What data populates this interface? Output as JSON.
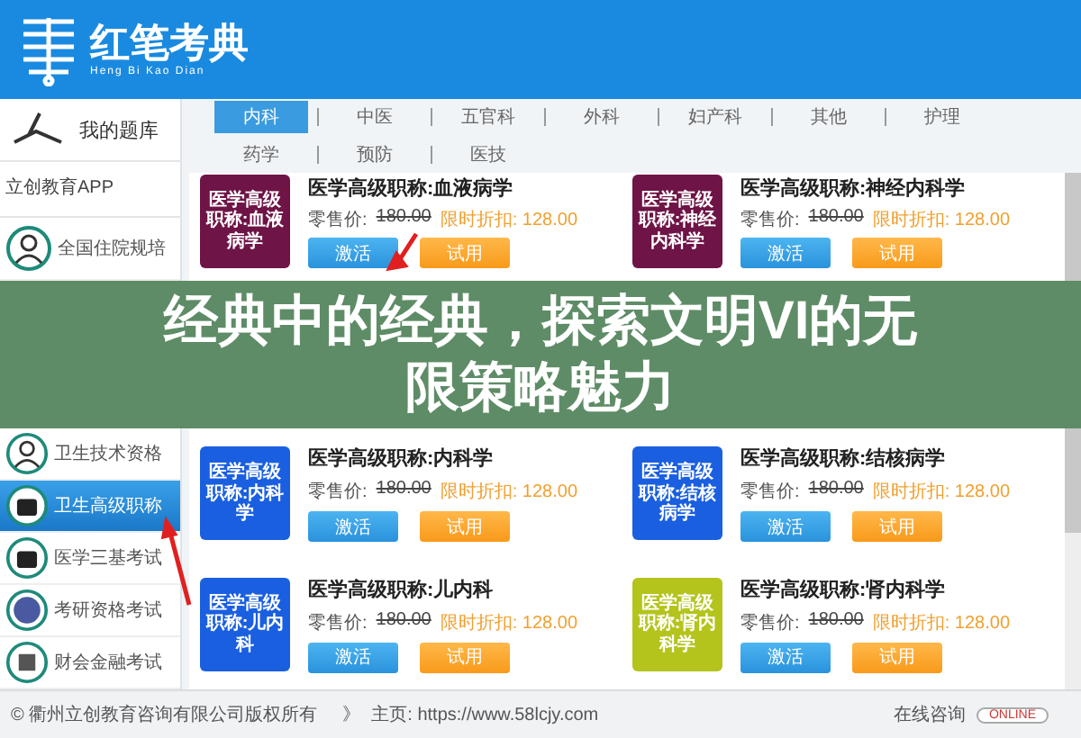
{
  "header": {
    "logo_title": "红笔考典",
    "logo_subtitle": "Heng Bi Kao Dian"
  },
  "sidebar": {
    "library": "我的题库",
    "section_heading": "立创教育APP",
    "items": [
      {
        "label": "全国住院规培",
        "selected": false
      },
      {
        "label": "卫生技术资格",
        "selected": false
      },
      {
        "label": "卫生高级职称",
        "selected": true
      },
      {
        "label": "医学三基考试",
        "selected": false
      },
      {
        "label": "考研资格考试",
        "selected": false
      },
      {
        "label": "财会金融考试",
        "selected": false
      }
    ]
  },
  "category_tabs": [
    {
      "label": "内科",
      "selected": true
    },
    {
      "label": "中医",
      "selected": false
    },
    {
      "label": "五官科",
      "selected": false
    },
    {
      "label": "外科",
      "selected": false
    },
    {
      "label": "妇产科",
      "selected": false
    },
    {
      "label": "其他",
      "selected": false
    },
    {
      "label": "护理",
      "selected": false
    },
    {
      "label": "药学",
      "selected": false
    },
    {
      "label": "预防",
      "selected": false
    },
    {
      "label": "医技",
      "selected": false
    }
  ],
  "cards": [
    {
      "color": "#6e1446",
      "cover_text": "医学高级职称:血液病学",
      "title": "医学高级职称:血液病学",
      "retail_label": "零售价:",
      "retail_price": "180.00",
      "discount_label": "限时折扣:",
      "discount_price": "128.00",
      "activate": "激活",
      "trial": "试用"
    },
    {
      "color": "#6e1446",
      "cover_text": "医学高级职称:神经内科学",
      "title": "医学高级职称:神经内科学",
      "retail_label": "零售价:",
      "retail_price": "180.00",
      "discount_label": "限时折扣:",
      "discount_price": "128.00",
      "activate": "激活",
      "trial": "试用"
    },
    {
      "color": "#1a5fe0",
      "cover_text": "医学高级职称:内科学",
      "title": "医学高级职称:内科学",
      "retail_label": "零售价:",
      "retail_price": "180.00",
      "discount_label": "限时折扣:",
      "discount_price": "128.00",
      "activate": "激活",
      "trial": "试用"
    },
    {
      "color": "#1a5fe0",
      "cover_text": "医学高级职称:结核病学",
      "title": "医学高级职称:结核病学",
      "retail_label": "零售价:",
      "retail_price": "180.00",
      "discount_label": "限时折扣:",
      "discount_price": "128.00",
      "activate": "激活",
      "trial": "试用"
    },
    {
      "color": "#1a5fe0",
      "cover_text": "医学高级职称:儿内科",
      "title": "医学高级职称:儿内科",
      "retail_label": "零售价:",
      "retail_price": "180.00",
      "discount_label": "限时折扣:",
      "discount_price": "128.00",
      "activate": "激活",
      "trial": "试用"
    },
    {
      "color": "#b4c41c",
      "cover_text": "医学高级职称:肾内科学",
      "title": "医学高级职称:肾内科学",
      "retail_label": "零售价:",
      "retail_price": "180.00",
      "discount_label": "限时折扣:",
      "discount_price": "128.00",
      "activate": "激活",
      "trial": "试用"
    }
  ],
  "banner": {
    "lines": [
      "经典中的经典，探索文明VI的无",
      "限策略魅力"
    ]
  },
  "footer": {
    "copyright": "© 衢州立创教育咨询有限公司版权所有",
    "separator": "》",
    "homepage": "主页: https://www.58lcjy.com",
    "consult": "在线咨询",
    "online_badge": "ONLINE"
  }
}
